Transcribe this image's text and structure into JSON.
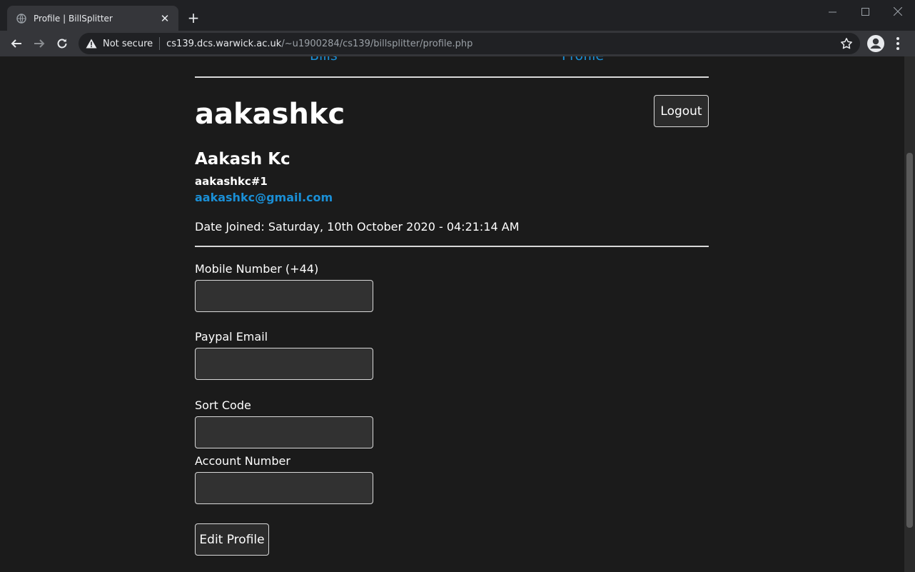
{
  "browser": {
    "tab_title": "Profile | BillSplitter",
    "security_label": "Not secure",
    "url_host": "cs139.dcs.warwick.ac.uk",
    "url_path": "/~u1900284/cs139/billsplitter/profile.php"
  },
  "nav": {
    "bills_label": "Bills",
    "profile_label": "Profile"
  },
  "profile": {
    "username": "aakashkc",
    "logout_label": "Logout",
    "full_name": "Aakash Kc",
    "tag": "aakashkc#1",
    "email": "aakashkc@gmail.com",
    "date_joined": "Date Joined: Saturday, 10th October 2020 - 04:21:14 AM"
  },
  "form": {
    "mobile_label": "Mobile Number (+44)",
    "mobile_value": "",
    "paypal_label": "Paypal Email",
    "paypal_value": "",
    "sortcode_label": "Sort Code",
    "sortcode_value": "",
    "account_label": "Account Number",
    "account_value": "",
    "edit_label": "Edit Profile"
  }
}
